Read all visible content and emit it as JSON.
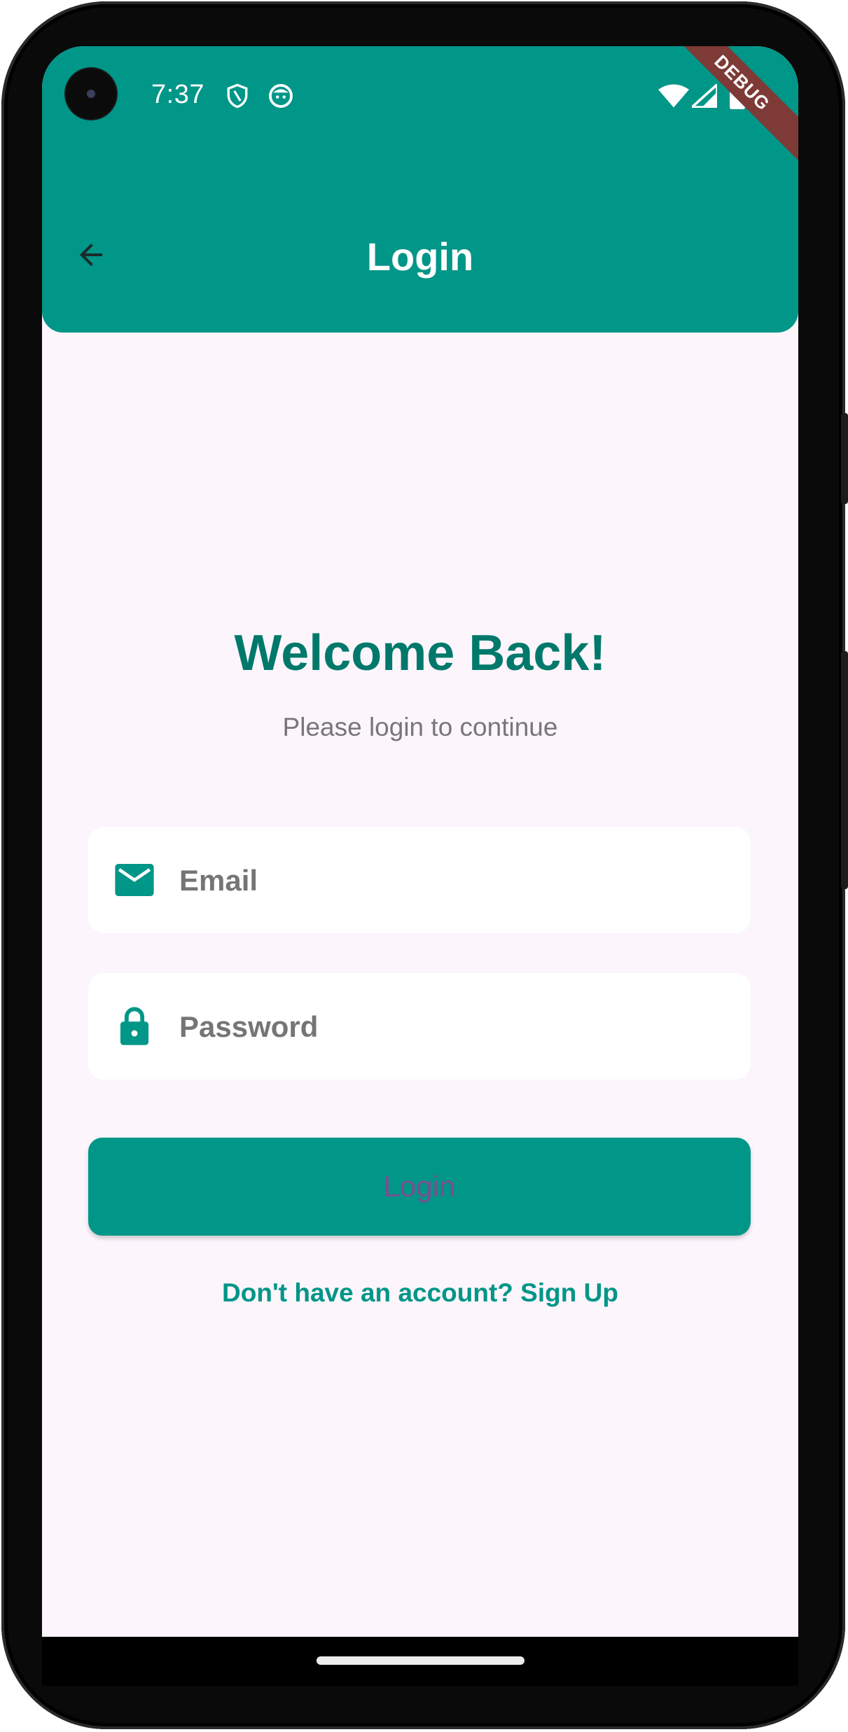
{
  "status_bar": {
    "time": "7:37",
    "icons": [
      "shield-icon",
      "face-icon",
      "wifi-icon",
      "cellular-icon",
      "battery-icon"
    ]
  },
  "debug_banner": "DEBUG",
  "app_bar": {
    "title": "Login",
    "back_icon": "arrow-back-icon",
    "color": "#009688"
  },
  "main": {
    "heading": "Welcome Back!",
    "subheading": "Please login to continue",
    "email": {
      "placeholder": "Email",
      "value": "",
      "icon": "mail-icon"
    },
    "password": {
      "placeholder": "Password",
      "value": "",
      "icon": "lock-icon"
    },
    "login_button": "Login",
    "signup_link": "Don't have an account? Sign Up"
  },
  "colors": {
    "primary": "#009688",
    "heading": "#00796b",
    "background": "#fcf5fc",
    "button_text": "#7b4f8f"
  }
}
